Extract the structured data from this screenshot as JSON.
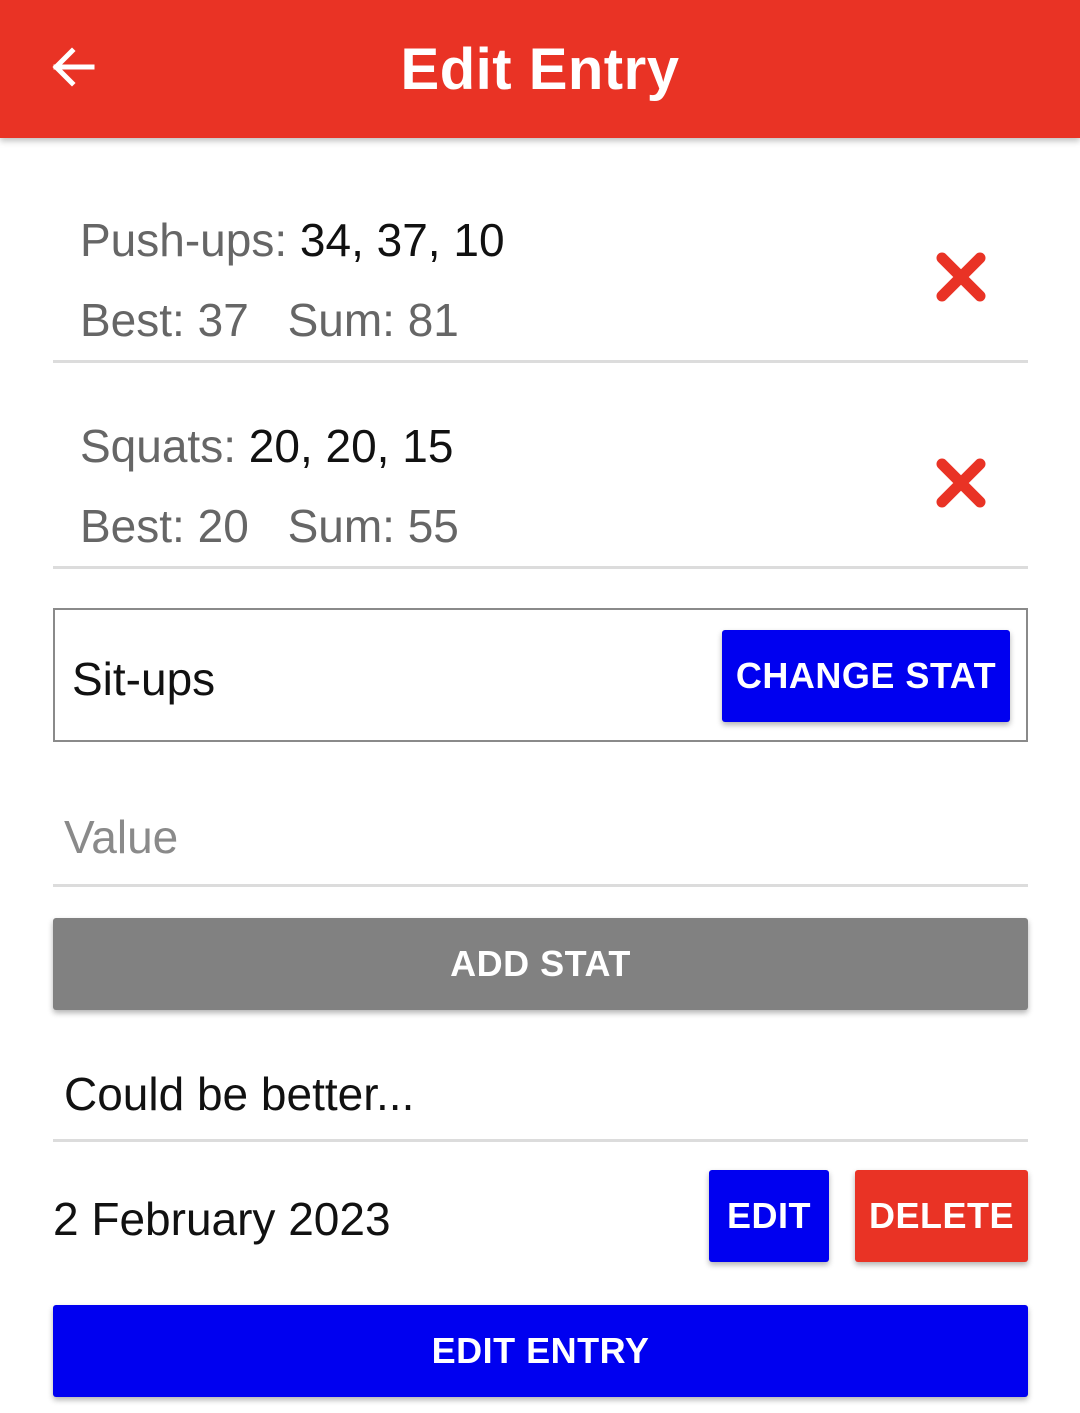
{
  "header": {
    "title": "Edit Entry",
    "color": "#e93325"
  },
  "stats": [
    {
      "name": "Push-ups:",
      "values": "34, 37, 10",
      "best_label": "Best:",
      "best": "37",
      "sum_label": "Sum:",
      "sum": "81"
    },
    {
      "name": "Squats:",
      "values": "20, 20, 15",
      "best_label": "Best:",
      "best": "20",
      "sum_label": "Sum:",
      "sum": "55"
    }
  ],
  "stat_picker": {
    "selected": "Sit-ups",
    "change_label": "CHANGE STAT"
  },
  "value_input": {
    "placeholder": "Value",
    "value": ""
  },
  "add_stat_label": "ADD STAT",
  "comment": "Could be better...",
  "date": {
    "text": "2 February 2023",
    "edit_label": "EDIT",
    "delete_label": "DELETE"
  },
  "edit_entry_label": "EDIT ENTRY",
  "icons": {
    "back": "arrow-left",
    "remove": "cross-mark"
  },
  "colors": {
    "primary_blue": "#0000f0",
    "danger_red": "#e93325",
    "disabled_grey": "#818181"
  }
}
